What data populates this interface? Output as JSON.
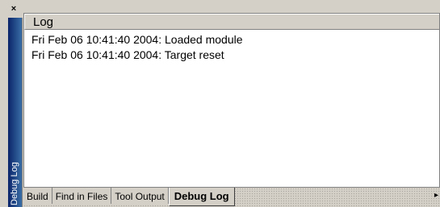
{
  "dock": {
    "close_label": "×",
    "title": "Debug Log"
  },
  "log": {
    "column_header": "Log",
    "entries": [
      "Fri Feb 06 10:41:40 2004: Loaded module",
      "Fri Feb 06 10:41:40 2004: Target reset"
    ]
  },
  "tabs": [
    {
      "label": "Build",
      "active": false
    },
    {
      "label": "Find in Files",
      "active": false
    },
    {
      "label": "Tool Output",
      "active": false
    },
    {
      "label": "Debug Log",
      "active": true
    }
  ],
  "tabstrip": {
    "scroll_right_icon": "▸"
  }
}
